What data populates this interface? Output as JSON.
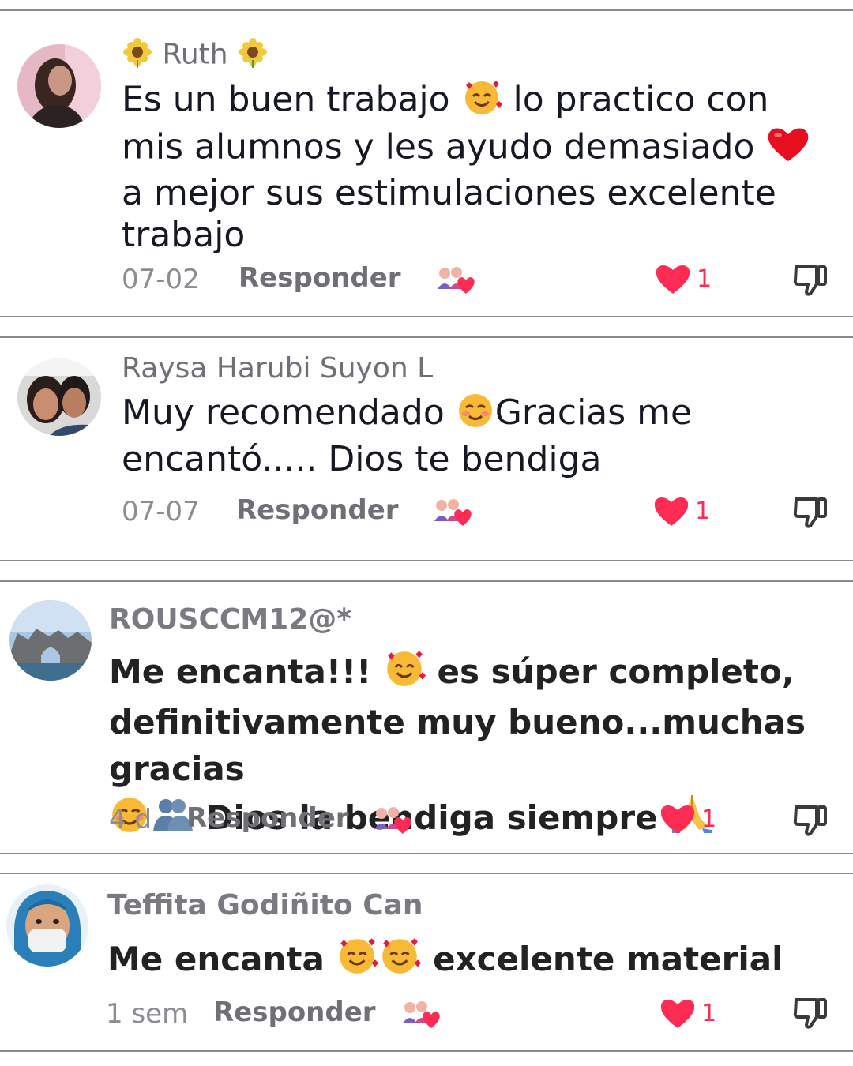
{
  "comments": [
    {
      "username": "Ruth",
      "text_parts": [
        "Es un buen trabajo ",
        " lo practico con",
        "mis alumnos y les ayudo demasiado ",
        "a mejor sus estimulaciones excelente",
        "trabajo"
      ],
      "date": "07-02",
      "reply_label": "Responder",
      "likes": "1"
    },
    {
      "username": "Raysa Harubi Suyon L",
      "text_parts": [
        "Muy recomendado ",
        "Gracias me",
        "encantó..... Dios te bendiga"
      ],
      "date": "07-07",
      "reply_label": "Responder",
      "likes": "1"
    },
    {
      "username": "ROUSCCM12@*",
      "text_parts": [
        "Me encanta!!! ",
        " es súper completo,",
        "definitivamente muy bueno...muchas gracias",
        " Dios la bendiga siempre "
      ],
      "date": "4 d",
      "reply_label": "Responder",
      "likes": "1"
    },
    {
      "username": "Teffita Godiñito Can",
      "text_parts": [
        "Me encanta ",
        " excelente material"
      ],
      "date": "1 sem",
      "reply_label": "Responder",
      "likes": "1"
    }
  ],
  "colors": {
    "like_red": "#fe2c55",
    "text_dark": "#161823",
    "text_gray": "#6f7075",
    "divider": "#8a8a8a"
  },
  "icons": [
    "sunflower-icon",
    "smiling-hearts-emoji",
    "red-heart-emoji",
    "blush-emoji",
    "busts-emoji",
    "pray-emoji",
    "duet-icon",
    "heart-icon",
    "dislike-icon"
  ]
}
